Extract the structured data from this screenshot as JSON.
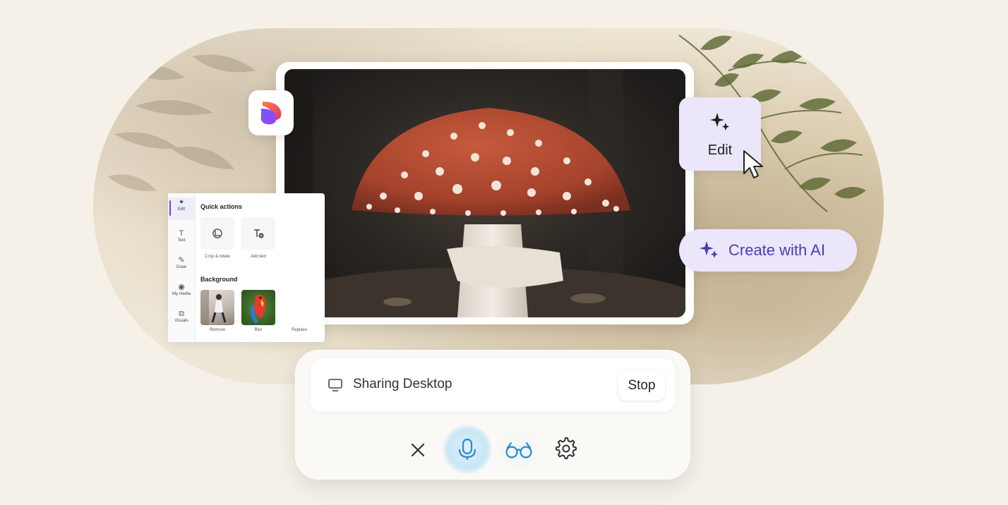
{
  "edit_chip": {
    "label": "Edit"
  },
  "create_ai": {
    "label": "Create with AI"
  },
  "edit_panel": {
    "rail": [
      {
        "label": "Edit",
        "icon": "sparkle-icon"
      },
      {
        "label": "Text",
        "icon": "text-icon"
      },
      {
        "label": "Draw",
        "icon": "pen-icon"
      },
      {
        "label": "My media",
        "icon": "media-icon"
      },
      {
        "label": "Visuals",
        "icon": "shapes-icon"
      }
    ],
    "quick_actions_heading": "Quick actions",
    "quick_actions": [
      {
        "label": "Crop & rotate",
        "icon": "crop-rotate-icon"
      },
      {
        "label": "Add text",
        "icon": "add-text-icon"
      }
    ],
    "background_heading": "Background",
    "background_options": [
      {
        "label": "Remove"
      },
      {
        "label": "Blur"
      },
      {
        "label": "Replace"
      }
    ]
  },
  "share_bar": {
    "status": "Sharing Desktop",
    "stop_label": "Stop"
  },
  "controls": [
    "close-icon",
    "microphone-icon",
    "vision-glasses-icon",
    "settings-gear-icon"
  ],
  "colors": {
    "accent": "#5b4fd6",
    "chip_bg": "#ece6fb",
    "page_bg": "#f5f1e8"
  }
}
